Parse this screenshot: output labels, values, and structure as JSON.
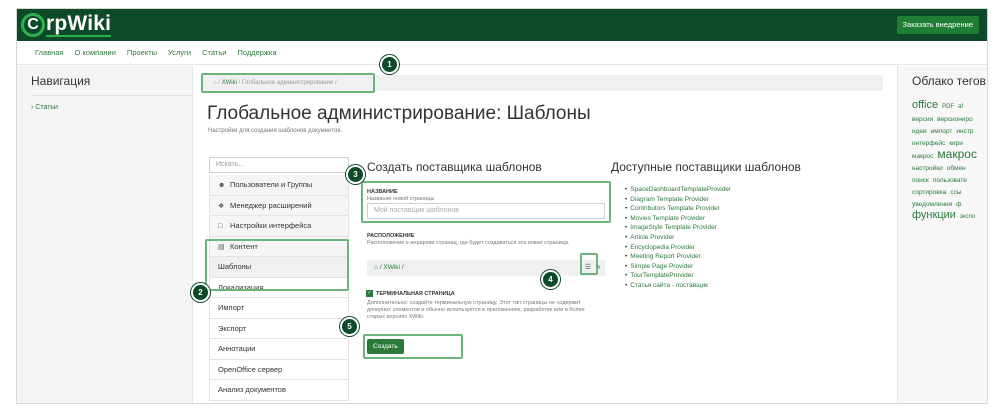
{
  "header": {
    "logo_letter": "C",
    "logo_text": "rpWiki",
    "order_button": "Заказать внедрение"
  },
  "menu": [
    "Главная",
    "О компании",
    "Проекты",
    "Услуги",
    "Статьи",
    "Поддержка"
  ],
  "left_nav": {
    "title": "Навигация",
    "link": "› Статьи"
  },
  "right_panel": {
    "title": "Облако тегов",
    "tags": [
      "office",
      "PDF",
      "af",
      "версии",
      "версиониро",
      "идеи",
      "импорт",
      "инстр",
      "интерфейс",
      "кири",
      "макрос",
      "макрос",
      "настройки",
      "обмен",
      "поиск",
      "пользовате",
      "сортировка",
      "ссы",
      "уведомления",
      "ф",
      "функции",
      "экспо"
    ]
  },
  "breadcrumb": {
    "home_icon": "home-icon",
    "items": [
      "XWiki",
      "Глобальное администрирование"
    ]
  },
  "page": {
    "title": "Глобальное администрирование: Шаблоны",
    "subtitle": "Настройки для создания шаблонов документов."
  },
  "admin_menu": {
    "search_placeholder": "Искать...",
    "items": [
      {
        "label": "Пользователи и Группы",
        "icon": "users-icon"
      },
      {
        "label": "Менеджер расширений",
        "icon": "puzzle-icon"
      },
      {
        "label": "Настройки интерфейса",
        "icon": "window-icon"
      },
      {
        "label": "Контент",
        "icon": "file-icon"
      },
      {
        "label": "Шаблоны"
      },
      {
        "label": "Локализация"
      },
      {
        "label": "Импорт"
      },
      {
        "label": "Экспорт"
      },
      {
        "label": "Аннотации"
      },
      {
        "label": "OpenOffice сервер"
      },
      {
        "label": "Анализ документов"
      }
    ]
  },
  "create_form": {
    "heading": "Создать поставщика шаблонов",
    "name_label": "НАЗВАНИЕ",
    "name_hint": "Название новой страницы",
    "name_placeholder": "Мой поставщик шаблонов",
    "location_label": "РАСПОЛОЖЕНИЕ",
    "location_hint": "Расположение в иерархии страниц, где будет создаваться эта новая страница.",
    "location_value": "XWiki",
    "terminal_label": "ТЕРМИНАЛЬНАЯ СТРАНИЦА",
    "terminal_checked": true,
    "terminal_hint": "Дополнительно: создайте терминальную страницу. Этот тип страницы не содержит дочерних элементов и обычно используется в приложениях, разработке или в более старых версиях XWiki.",
    "create_button": "Создать"
  },
  "providers": {
    "heading": "Доступные поставщики шаблонов",
    "items": [
      "SpaceDashboardTemplateProvider",
      "Diagram Template Provider",
      "Contributors Template Provider",
      "Movies Template Provider",
      "ImageStyle Template Provider",
      "Article Provider",
      "Encyclopedia Provider",
      "Meeting Report Provider",
      "Simple Page Provider",
      "TourTemplateProvider",
      "Статья сайта - поставщик"
    ]
  },
  "callouts": [
    "1",
    "2",
    "3",
    "4",
    "5"
  ],
  "colors": {
    "brand_dark": "#0d4a2a",
    "link_green": "#2b7a3a",
    "highlight": "#6cb37c"
  }
}
